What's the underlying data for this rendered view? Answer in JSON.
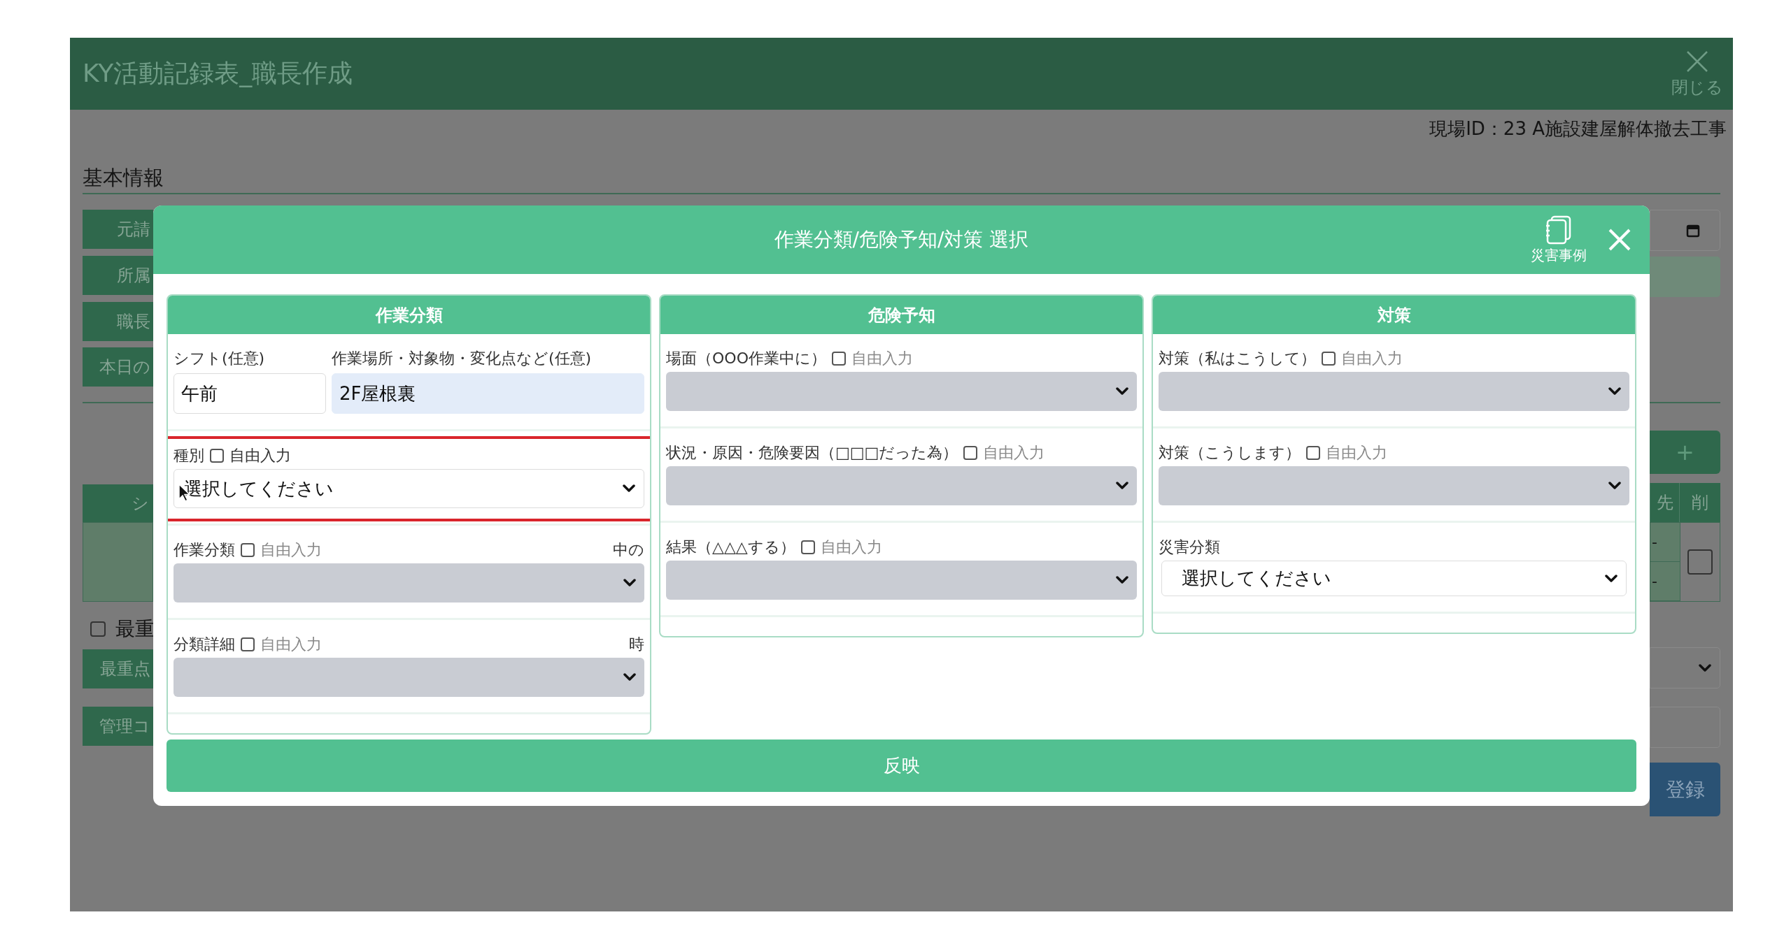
{
  "app": {
    "title": "KY活動記録表_職長作成",
    "close_label": "閉じる",
    "site_id": "現場ID：23 A施設建屋解体撤去工事",
    "section_title": "基本情報",
    "left_buttons": [
      "元請",
      "所属",
      "職長",
      "本日の"
    ],
    "table_header": "シ",
    "priority_checkbox": {
      "label": "最重",
      "checked": false
    },
    "lower_buttons": [
      "最重点",
      "管理コ"
    ],
    "right": {
      "plus_label": "+",
      "table_columns": [
        "先",
        "削"
      ],
      "row_cells": [
        "-",
        "-"
      ],
      "row_checkbox": {
        "checked": false
      },
      "submit_label": "登録"
    }
  },
  "modal": {
    "title": "作業分類/危険予知/対策 選択",
    "cases_label": "災害事例",
    "columns": [
      {
        "title": "作業分類",
        "fields": [
          {
            "kind": "inputs",
            "inputs": [
              {
                "label": "シフト(任意)",
                "value": "午前",
                "autofilled": false
              },
              {
                "label": "作業場所・対象物・変化点など(任意)",
                "value": "2F屋根裏",
                "autofilled": true
              }
            ]
          },
          {
            "kind": "select",
            "label": "種別",
            "free_input": {
              "label": "自由入力",
              "checked": false
            },
            "value": "選択してください",
            "disabled": false,
            "marked": true,
            "cursor_over": true
          },
          {
            "kind": "select",
            "label": "作業分類",
            "free_input": {
              "label": "自由入力",
              "checked": false
            },
            "note": "中の",
            "disabled": true
          },
          {
            "kind": "select",
            "label": "分類詳細",
            "free_input": {
              "label": "自由入力",
              "checked": false
            },
            "note": "時",
            "disabled": true
          }
        ]
      },
      {
        "title": "危険予知",
        "fields": [
          {
            "kind": "select",
            "label": "場面（OOO作業中に）",
            "free_input": {
              "label": "自由入力",
              "checked": false
            },
            "disabled": true
          },
          {
            "kind": "select",
            "label": "状況・原因・危険要因（□□□だった為）",
            "free_input": {
              "label": "自由入力",
              "checked": false
            },
            "disabled": true
          },
          {
            "kind": "select",
            "label": "結果（△△△する）",
            "free_input": {
              "label": "自由入力",
              "checked": false
            },
            "disabled": true
          }
        ]
      },
      {
        "title": "対策",
        "fields": [
          {
            "kind": "select",
            "label": "対策（私はこうして）",
            "free_input": {
              "label": "自由入力",
              "checked": false
            },
            "disabled": true
          },
          {
            "kind": "select",
            "label": "対策（こうします）",
            "free_input": {
              "label": "自由入力",
              "checked": false
            },
            "disabled": true
          },
          {
            "kind": "plain_select",
            "label": "災害分類",
            "value": "選択してください",
            "disabled": false
          }
        ]
      }
    ],
    "reflect_label": "反映"
  }
}
